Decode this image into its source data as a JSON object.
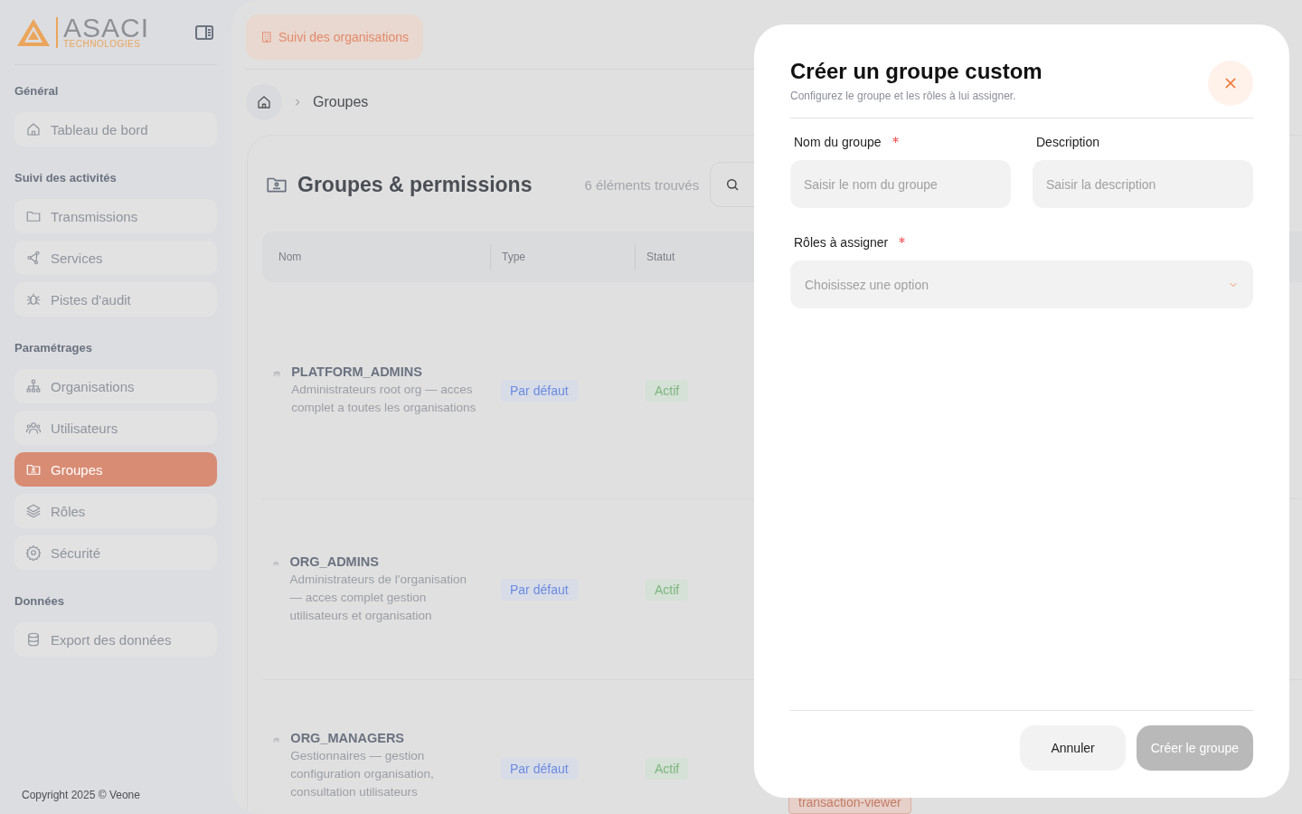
{
  "sidebar": {
    "logo": {
      "name": "ASACI",
      "tagline": "TECHNOLOGIES"
    },
    "sections": [
      {
        "title": "Général",
        "items": [
          {
            "label": "Tableau de bord",
            "selected": false
          }
        ]
      },
      {
        "title": "Suivi des activités",
        "items": [
          {
            "label": "Transmissions",
            "selected": false
          },
          {
            "label": "Services",
            "selected": false
          },
          {
            "label": "Pistes d'audit",
            "selected": false
          }
        ]
      },
      {
        "title": "Paramétrages",
        "items": [
          {
            "label": "Organisations",
            "selected": false
          },
          {
            "label": "Utilisateurs",
            "selected": false
          },
          {
            "label": "Groupes",
            "selected": true
          },
          {
            "label": "Rôles",
            "selected": false
          },
          {
            "label": "Sécurité",
            "selected": false
          }
        ]
      },
      {
        "title": "Données",
        "items": [
          {
            "label": "Export des données",
            "selected": false
          }
        ]
      }
    ],
    "copyright": "Copyright 2025 © Veone"
  },
  "topbar": {
    "button": "Suivi des organisations"
  },
  "breadcrumb": {
    "current": "Groupes"
  },
  "card": {
    "title": "Groupes & permissions",
    "count": "6 éléments trouvés"
  },
  "table": {
    "columns": [
      "Nom",
      "Type",
      "Statut"
    ],
    "rows": [
      {
        "name": "PLATFORM_ADMINS",
        "description": "Administrateurs root org — acces complet a toutes les organisations",
        "type": "Par défaut",
        "status": "Actif"
      },
      {
        "name": "ORG_ADMINS",
        "description": "Administrateurs de l'organisation — acces complet gestion utilisateurs et organisation",
        "type": "Par défaut",
        "status": "Actif"
      },
      {
        "name": "ORG_MANAGERS",
        "description": "Gestionnaires — gestion configuration organisation, consultation utilisateurs",
        "type": "Par défaut",
        "status": "Actif",
        "column_4": [
          "transaction-viewer"
        ]
      }
    ]
  },
  "modal": {
    "title": "Créer un groupe custom",
    "subtitle": "Configurez le groupe et les rôles à lui assigner.",
    "fields": [
      {
        "label": "Nom du groupe",
        "required": true,
        "placeholder": "Saisir le nom du groupe"
      },
      {
        "label": "Description",
        "required": false,
        "placeholder": "Saisir la description"
      }
    ],
    "select": {
      "label": "Rôles à assigner",
      "required": true,
      "placeholder": "Choisissez une option"
    },
    "buttons": [
      {
        "label": "Annuler",
        "kind": "secondary",
        "disabled": false
      },
      {
        "label": "Créer le groupe",
        "kind": "primary",
        "disabled": true
      }
    ]
  }
}
